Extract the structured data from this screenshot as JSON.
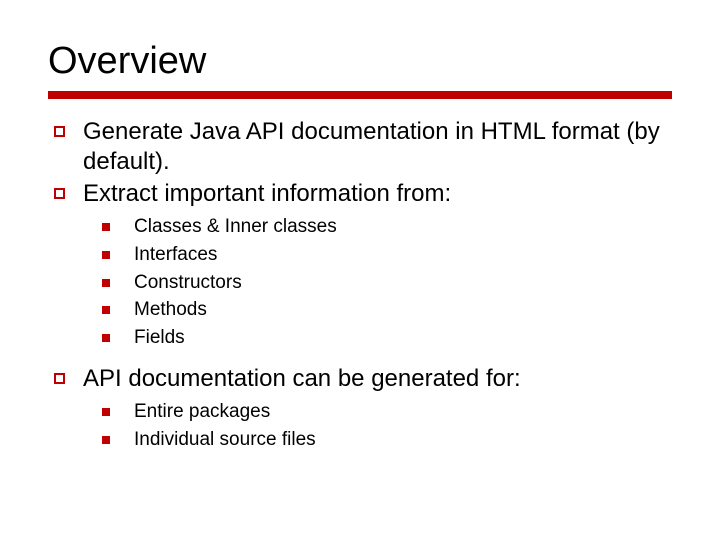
{
  "title": "Overview",
  "points": [
    {
      "text": "Generate Java API documentation in HTML format (by default)."
    },
    {
      "text": "Extract important information from:",
      "sub": [
        "Classes & Inner classes",
        "Interfaces",
        "Constructors",
        "Methods",
        "Fields"
      ]
    },
    {
      "text": "API documentation can be generated for:",
      "sub": [
        "Entire packages",
        "Individual source files"
      ]
    }
  ]
}
